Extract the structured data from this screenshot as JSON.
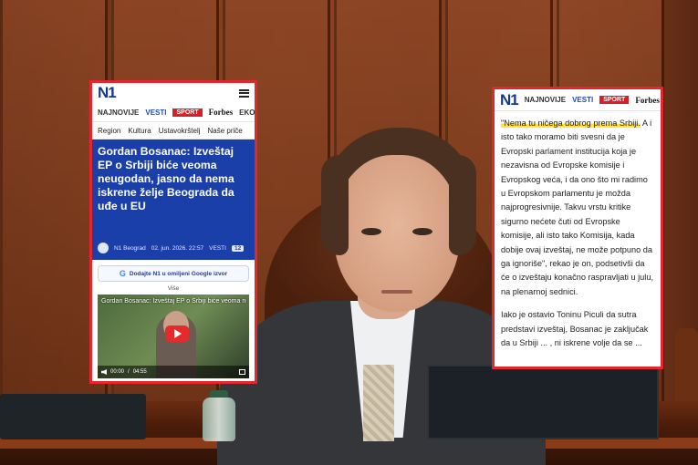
{
  "colors": {
    "accent_red": "#e4262e",
    "n1_blue": "#1a3fa8",
    "highlight": "#ffe23a"
  },
  "left_card": {
    "logo": "N1",
    "menu_icon": "hamburger-icon",
    "nav": {
      "item1": "NAJNOVIJE",
      "item2": "VESTI",
      "item3": "SPORT",
      "item4": "Forbes",
      "item5": "EKONO"
    },
    "subnav": {
      "item1": "Region",
      "item2": "Kultura",
      "item3": "Ustavokrštelj",
      "item4": "Naše priče"
    },
    "headline": "Gordan Bosanac: Izveštaj EP o Srbiji biće veoma neugodan, jasno da nema iskrene želje Beograda da uđe u EU",
    "meta": {
      "author": "N1 Beograd",
      "date": "02. jun. 2026. 22:57",
      "section": "VESTI",
      "count": "12"
    },
    "google_button": "Dodajte N1 u omiljeni Google izvor",
    "more": "Više",
    "video": {
      "title": "Gordan Bosanac: Izveštaj EP o Srbiji biće veoma n...",
      "time": "00:00",
      "duration": "04:55"
    }
  },
  "right_card": {
    "logo": "N1",
    "nav": {
      "item1": "NAJNOVIJE",
      "item2": "VESTI",
      "item3": "SPORT",
      "item4": "Forbes"
    },
    "highlighted_quote": "\"Nema tu ničega dobrog prema Srbiji.",
    "paragraph1_rest": " A i isto tako moramo biti svesni da je Evropski parlament institucija koja je nezavisna od Evropske komisije i Evropskog veća, i da ono što mi radimo u Evropskom parlamentu je možda najprogresivnije. Takvu vrstu kritike sigurno nećete čuti od Evropske komisije, ali isto tako Komisija, kada dobije ovaj izveštaj, ne može potpuno da ga ignoriše\", rekao je on, podsetivši da će o izveštaju konačno raspravljati u julu, na plenarnoj sednici.",
    "paragraph2": "Iako je ostavio Toninu Piculi da sutra predstavi izveštaj, Bosanac je zaključak da u Srbiji ... , ni iskrene volje da se ..."
  }
}
